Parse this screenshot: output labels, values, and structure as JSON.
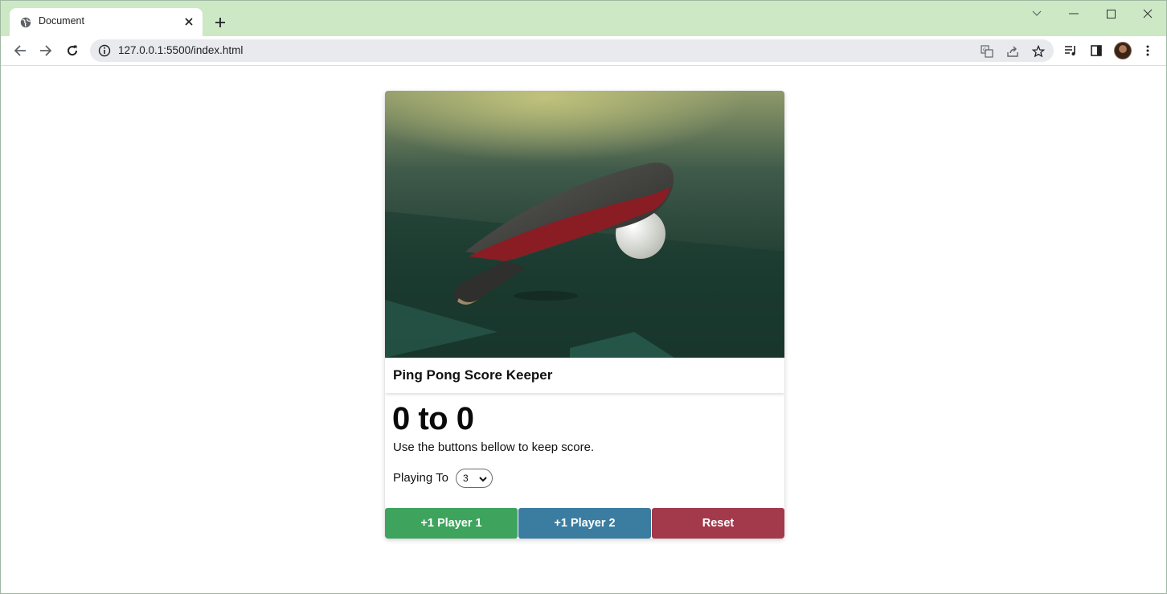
{
  "browser": {
    "tab_title": "Document",
    "url": "127.0.0.1:5500/index.html"
  },
  "card": {
    "title": "Ping Pong Score Keeper",
    "score_text": "0 to 0",
    "instructions": "Use the buttons bellow to keep score.",
    "playing_to_label": "Playing To",
    "playing_to_value": "3",
    "buttons": {
      "player1": "+1 Player 1",
      "player2": "+1 Player 2",
      "reset": "Reset"
    }
  },
  "colors": {
    "player1": "#3ea35d",
    "player2": "#3b7da0",
    "reset": "#a23a4c",
    "tabstrip": "#cce8c4"
  }
}
